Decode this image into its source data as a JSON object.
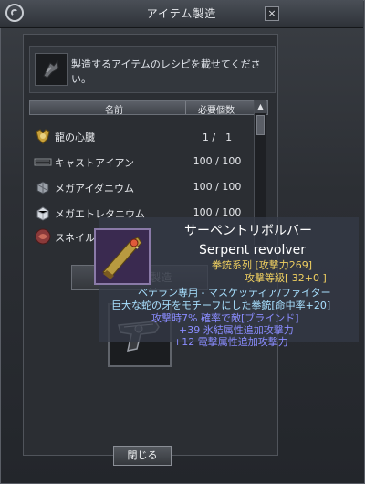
{
  "window": {
    "title": "アイテム製造",
    "close_glyph": "×"
  },
  "instruction": {
    "text": "製造するアイテムのレシピを載せてください。"
  },
  "table": {
    "headers": {
      "name": "名前",
      "count": "必要個数"
    },
    "rows": [
      {
        "icon": "dragon-heart-icon",
        "name": "龍の心臓",
        "count": "1 /　1"
      },
      {
        "icon": "cast-iron-icon",
        "name": "キャストアイアン",
        "count": "100 / 100"
      },
      {
        "icon": "mega-idanium-icon",
        "name": "メガアイダニウム",
        "count": "100 / 100"
      },
      {
        "icon": "mega-eteltanium-icon",
        "name": "メガエトレタニウム",
        "count": "100 / 100"
      },
      {
        "icon": "snake-item-icon",
        "name": "スネイル",
        "count": ""
      }
    ]
  },
  "buttons": {
    "craft": "アイテム製造",
    "close": "閉じる"
  },
  "tooltip": {
    "name_jp": "サーペントリボルバー",
    "name_en": "Serpent revolver",
    "type_line": "拳銃系列 [攻撃力269]",
    "grade_line": "攻撃等級[ 32+0 ]",
    "class_line": "ベテラン専用 - マスケッティア/ファイター",
    "desc_line": "巨大な蛇の牙をモチーフにした拳銃[命中率+20]",
    "effect_line": "攻撃時7% 確率で敵[ブラインド]",
    "ice_line": "+39 氷結属性追加攻撃力",
    "lightning_line": "+12 電撃属性追加攻撃力"
  },
  "colors": {
    "tooltip_name": "#ffffff",
    "tooltip_stat": "#f0d060",
    "tooltip_desc": "#a8e0ff",
    "tooltip_effect": "#8a8cff"
  }
}
